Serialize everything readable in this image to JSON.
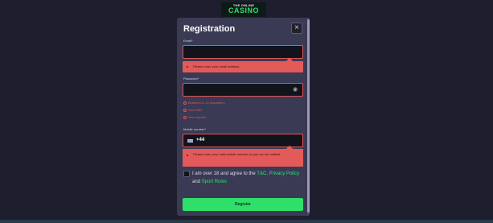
{
  "logo": {
    "line1": "THE ONLINE",
    "line2": "CASINO",
    "brand_color": "#2ee06a"
  },
  "modal": {
    "title": "Registration",
    "close_icon": "×"
  },
  "email": {
    "label": "Email*",
    "value": "",
    "error": "Please enter your email address"
  },
  "password": {
    "label": "Password*",
    "value": "",
    "eye_icon": "eye-icon",
    "rules": [
      "Between 8- 20 characters",
      "One letter",
      "One number"
    ]
  },
  "mobile": {
    "label": "Mobile number*",
    "country_flag": "uk-flag-icon",
    "prefix": "+44",
    "error": "Please enter your valid mobile number so you can be notified."
  },
  "terms": {
    "text_before": "I am over 18 and agree to the",
    "link1": "T&C",
    "comma": ",",
    "link2": "Privacy Policy",
    "and": "and",
    "link3": "Sport Rules"
  },
  "register_button": "Register",
  "colors": {
    "error": "#e35a5a",
    "background": "#1e1e2e",
    "modal": "#3a3a55"
  }
}
